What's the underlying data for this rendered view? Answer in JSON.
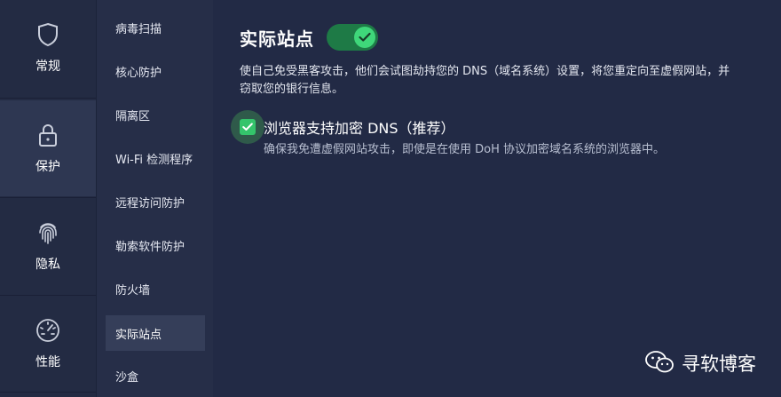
{
  "rail": {
    "items": [
      {
        "label": "常规",
        "icon": "shield-icon"
      },
      {
        "label": "保护",
        "icon": "lock-icon",
        "active": true
      },
      {
        "label": "隐私",
        "icon": "fingerprint-icon"
      },
      {
        "label": "性能",
        "icon": "gauge-icon"
      }
    ]
  },
  "subnav": {
    "items": [
      "病毒扫描",
      "核心防护",
      "隔离区",
      "Wi-Fi 检测程序",
      "远程访问防护",
      "勒索软件防护",
      "防火墙",
      "实际站点",
      "沙盒"
    ],
    "active_index": 7
  },
  "main": {
    "title": "实际站点",
    "toggle_on": true,
    "description": "使自己免受黑客攻击，他们会试图劫持您的 DNS（域名系统）设置，将您重定向至虚假网站，并窃取您的银行信息。",
    "option": {
      "checked": true,
      "label": "浏览器支持加密 DNS（推荐）",
      "description": "确保我免遭虚假网站攻击，即使是在使用 DoH 协议加密域名系统的浏览器中。"
    }
  },
  "watermark": {
    "text": "寻软博客",
    "icon": "wechat-icon"
  },
  "colors": {
    "background": "#222a45",
    "accent_green": "#34c46b",
    "toggle_track": "#1e7a46"
  }
}
